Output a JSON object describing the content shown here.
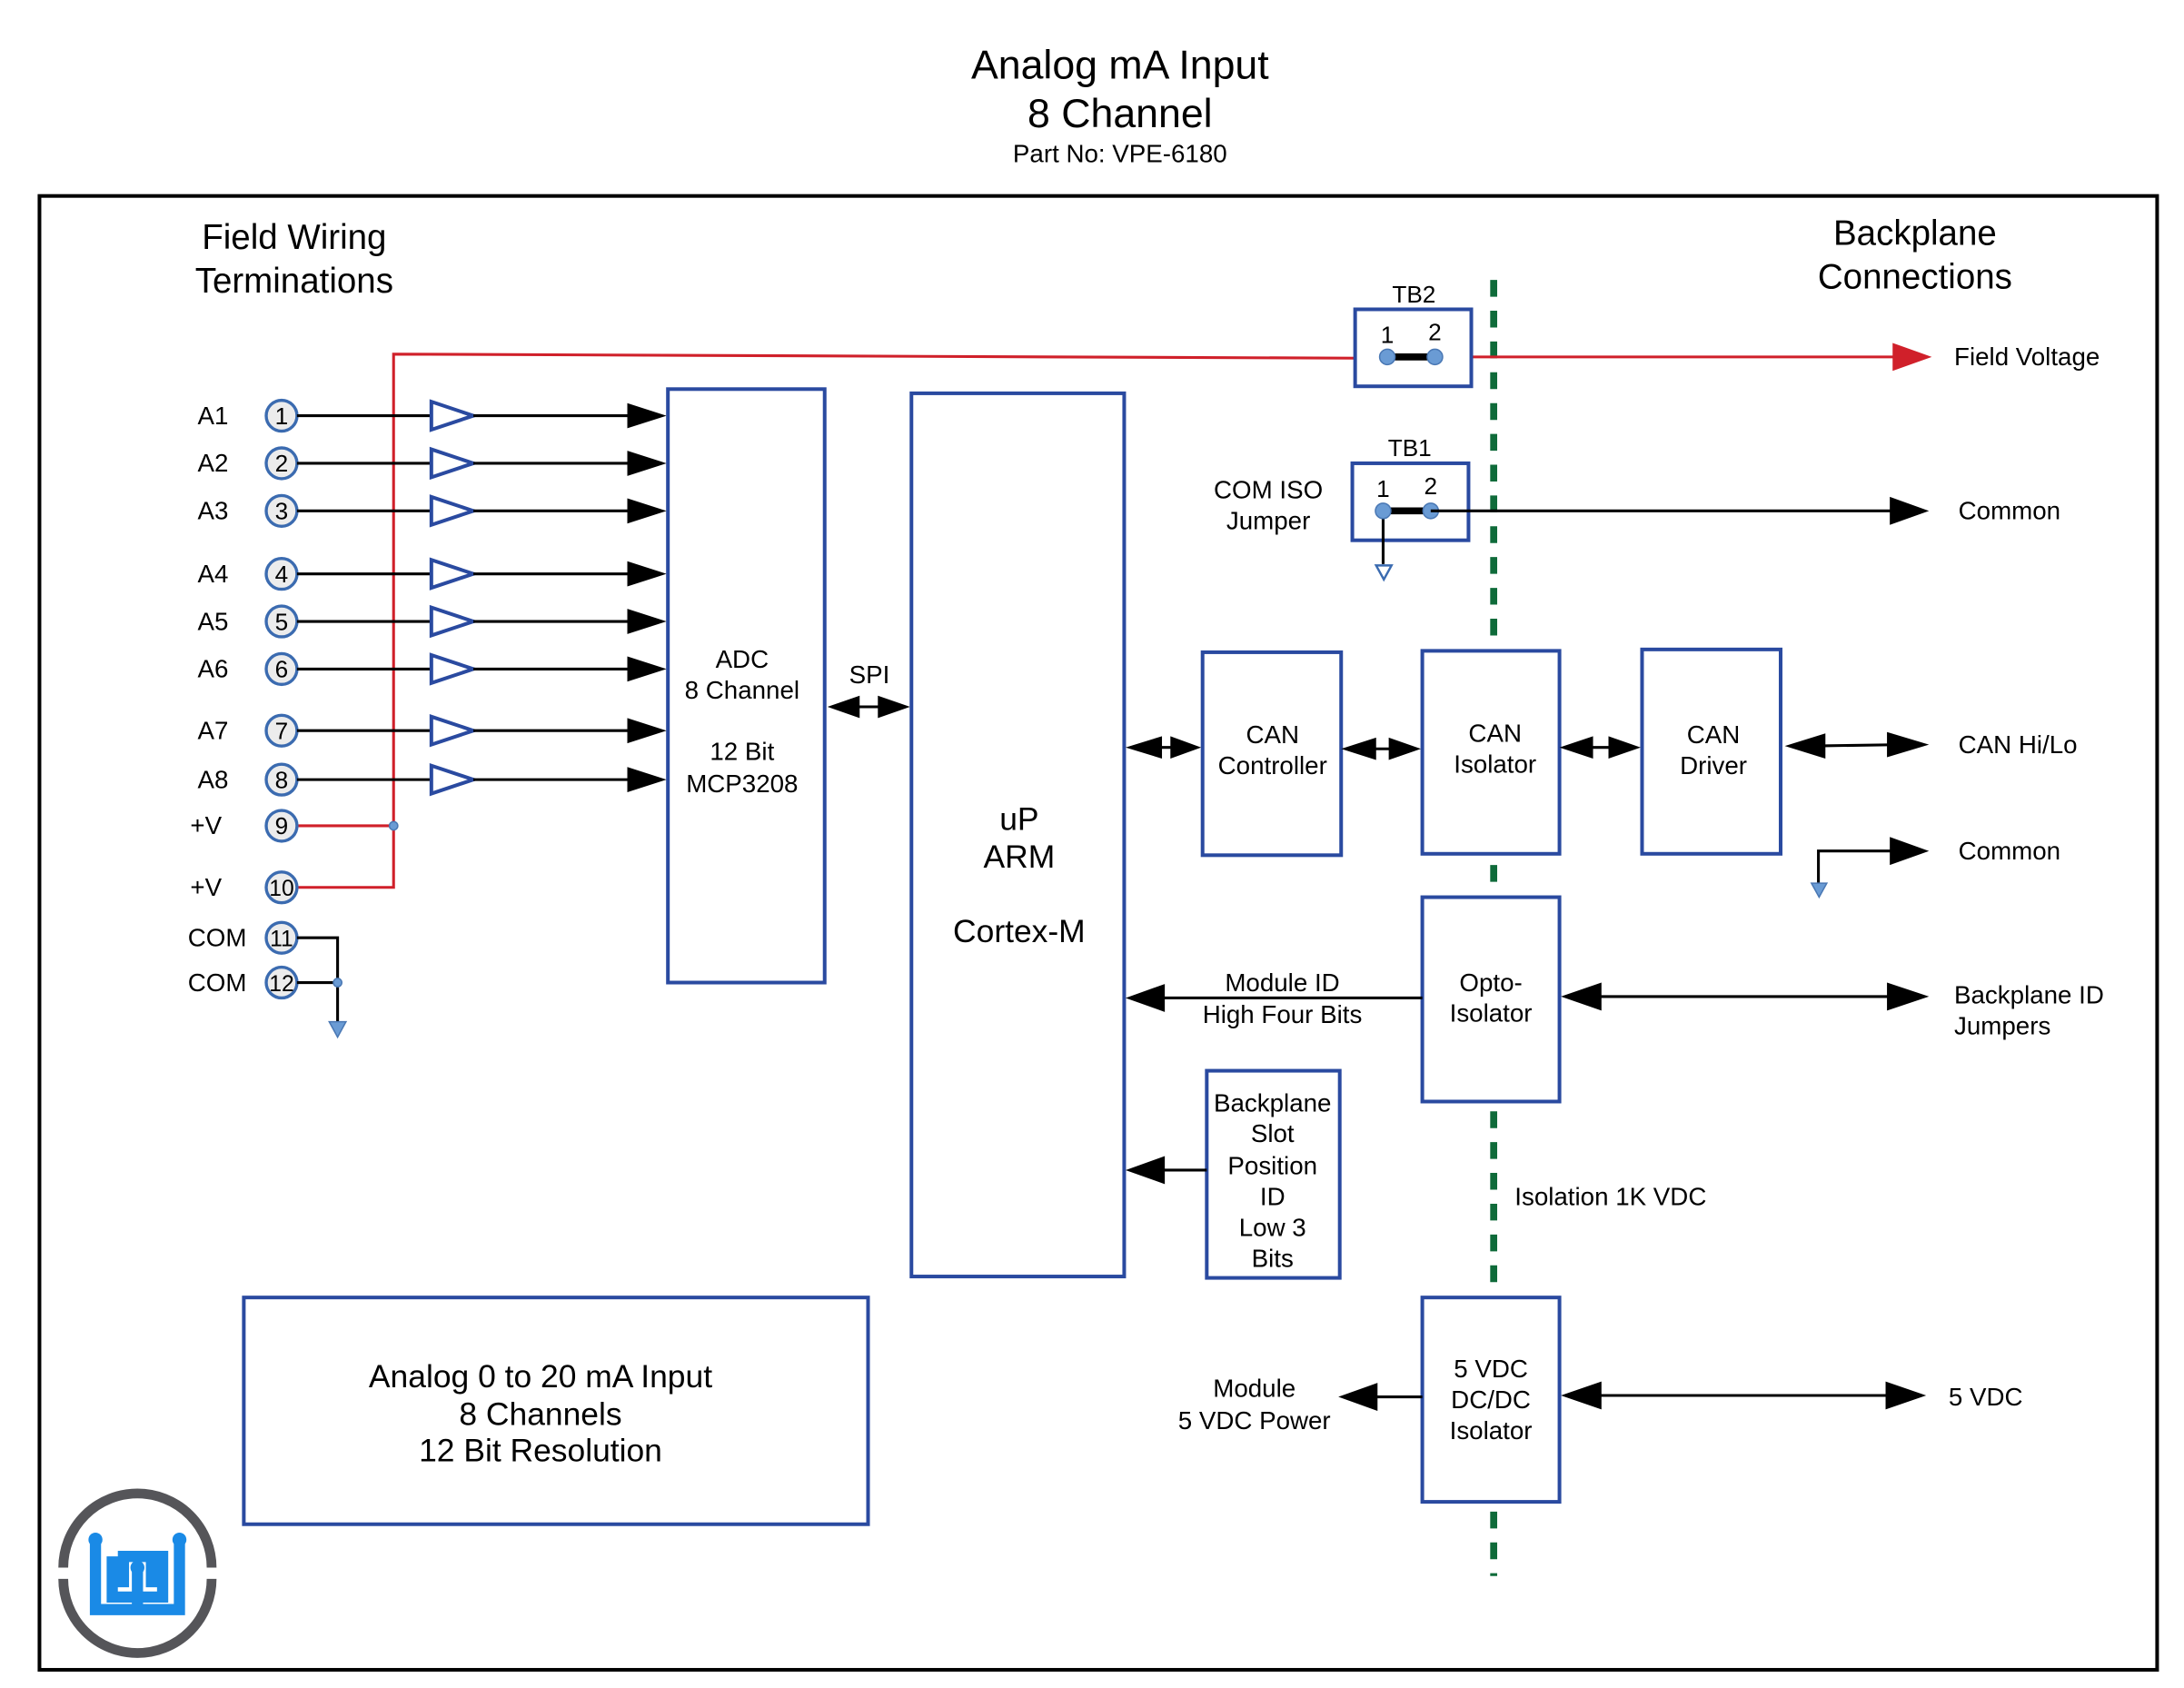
{
  "title": {
    "line1": "Analog mA Input",
    "line2": "8 Channel",
    "part_no": "Part No: VPE-6180"
  },
  "sections": {
    "field_line1": "Field Wiring",
    "field_line2": "Terminations",
    "backplane_line1": "Backplane",
    "backplane_line2": "Connections"
  },
  "terminals": [
    {
      "label": "A1",
      "num": "1"
    },
    {
      "label": "A2",
      "num": "2"
    },
    {
      "label": "A3",
      "num": "3"
    },
    {
      "label": "A4",
      "num": "4"
    },
    {
      "label": "A5",
      "num": "5"
    },
    {
      "label": "A6",
      "num": "6"
    },
    {
      "label": "A7",
      "num": "7"
    },
    {
      "label": "A8",
      "num": "8"
    },
    {
      "label": "+V",
      "num": "9"
    },
    {
      "label": "+V",
      "num": "10"
    },
    {
      "label": "COM",
      "num": "11"
    },
    {
      "label": "COM",
      "num": "12"
    }
  ],
  "blocks": {
    "adc": {
      "l1": "ADC",
      "l2": "8 Channel",
      "l3": "12 Bit",
      "l4": "MCP3208"
    },
    "spi": "SPI",
    "up": {
      "l1": "uP",
      "l2": "ARM",
      "l3": "Cortex-M"
    },
    "can_controller": {
      "l1": "CAN",
      "l2": "Controller"
    },
    "can_isolator": {
      "l1": "CAN",
      "l2": "Isolator"
    },
    "can_driver": {
      "l1": "CAN",
      "l2": "Driver"
    },
    "opto": {
      "l1": "Opto-",
      "l2": "Isolator"
    },
    "slot": {
      "l1": "Backplane",
      "l2": "Slot",
      "l3": "Position",
      "l4": "ID",
      "l5": "Low 3",
      "l6": "Bits"
    },
    "dcdc": {
      "l1": "5 VDC",
      "l2": "DC/DC",
      "l3": "Isolator"
    },
    "summary": {
      "l1": "Analog 0 to 20 mA Input",
      "l2": "8 Channels",
      "l3": "12 Bit Resolution"
    }
  },
  "jumpers": {
    "tb2": {
      "name": "TB2",
      "p1": "1",
      "p2": "2"
    },
    "tb1": {
      "name": "TB1",
      "p1": "1",
      "p2": "2"
    },
    "com_iso_l1": "COM ISO",
    "com_iso_l2": "Jumper"
  },
  "signals": {
    "module_id_l1": "Module ID",
    "module_id_l2": "High Four Bits",
    "module_power_l1": "Module",
    "module_power_l2": "5 VDC Power",
    "isolation": "Isolation 1K VDC"
  },
  "outputs": {
    "field_voltage": "Field Voltage",
    "common1": "Common",
    "can_hilo": "CAN Hi/Lo",
    "common2": "Common",
    "backplane_id_l1": "Backplane ID",
    "backplane_id_l2": "Jumpers",
    "vdc5": "5 VDC"
  },
  "colors": {
    "block_border": "#2a4aa0",
    "field_voltage_line": "#d0202a",
    "isolation_barrier": "#0f6b3a",
    "logo_ring": "#555559",
    "logo_mark": "#1a8ae6"
  }
}
